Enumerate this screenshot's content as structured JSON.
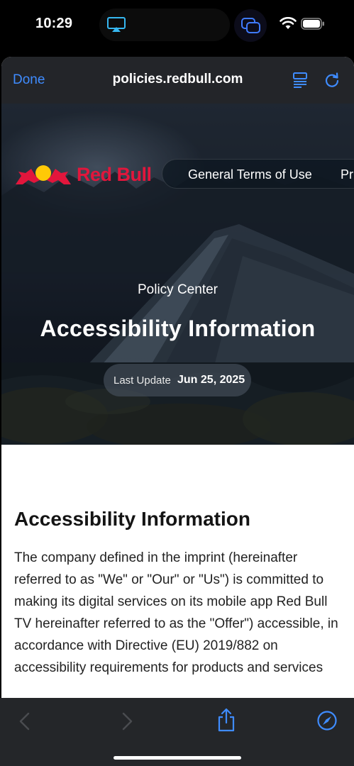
{
  "status_bar": {
    "time": "10:29"
  },
  "browser": {
    "done_label": "Done",
    "url": "policies.redbull.com"
  },
  "header": {
    "brand": "Red Bull",
    "nav": [
      "General Terms of Use",
      "Pri"
    ]
  },
  "hero": {
    "eyebrow": "Policy Center",
    "title": "Accessibility Information",
    "update_label": "Last Update",
    "update_date": "Jun 25, 2025"
  },
  "article": {
    "heading": "Accessibility Information",
    "body": "The company defined in the imprint (hereinafter referred to as \"We\" or \"Our\" or \"Us\") is committed to making its digital services on its mobile app Red Bull TV hereinafter referred to as the \"Offer\") accessible, in accordance with Directive (EU) 2019/882 on accessibility requirements for products and services"
  },
  "colors": {
    "accent": "#3f8cff",
    "brand_red": "#e2163c",
    "brand_yellow": "#ffc906"
  },
  "icons": [
    "airplay-icon",
    "cards-icon",
    "wifi-icon",
    "battery-icon",
    "reader-icon",
    "reload-icon",
    "back-icon",
    "forward-icon",
    "share-icon",
    "compass-icon"
  ]
}
